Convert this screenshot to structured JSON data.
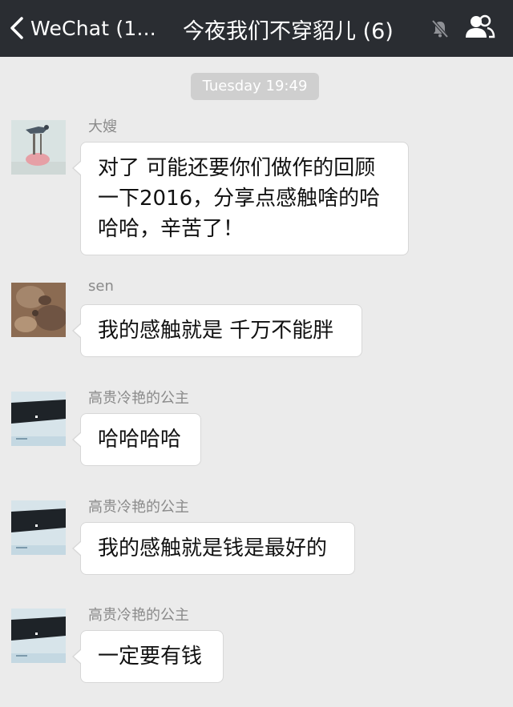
{
  "nav": {
    "back_label": "WeChat (1...",
    "title": "今夜我们不穿貂儿 (6)",
    "icons": {
      "back": "chevron-left-icon",
      "mute": "bell-muted-icon",
      "group": "group-members-icon"
    }
  },
  "timestamp": "Tuesday 19:49",
  "messages": [
    {
      "sender": "大嫂",
      "avatar": "flamingo-sculpture-avatar",
      "lines": [
        "对了 可能还要你们做作的回顾",
        "一下2016，分享点感触啥的哈",
        "哈哈，辛苦了！"
      ]
    },
    {
      "sender": "sen",
      "avatar": "brown-rock-avatar",
      "lines": [
        "我的感触就是 千万不能胖"
      ]
    },
    {
      "sender": "高贵冷艳的公主",
      "avatar": "dark-band-photo-avatar",
      "lines": [
        "哈哈哈哈"
      ]
    },
    {
      "sender": "高贵冷艳的公主",
      "avatar": "dark-band-photo-avatar",
      "lines": [
        "我的感触就是钱是最好的"
      ]
    },
    {
      "sender": "高贵冷艳的公主",
      "avatar": "dark-band-photo-avatar",
      "lines": [
        "一定要有钱"
      ]
    }
  ],
  "colors": {
    "nav_bg": "#2a2d32",
    "chat_bg": "#ebebeb",
    "bubble_bg": "#ffffff",
    "timestamp_bg": "#cfcfcf"
  }
}
